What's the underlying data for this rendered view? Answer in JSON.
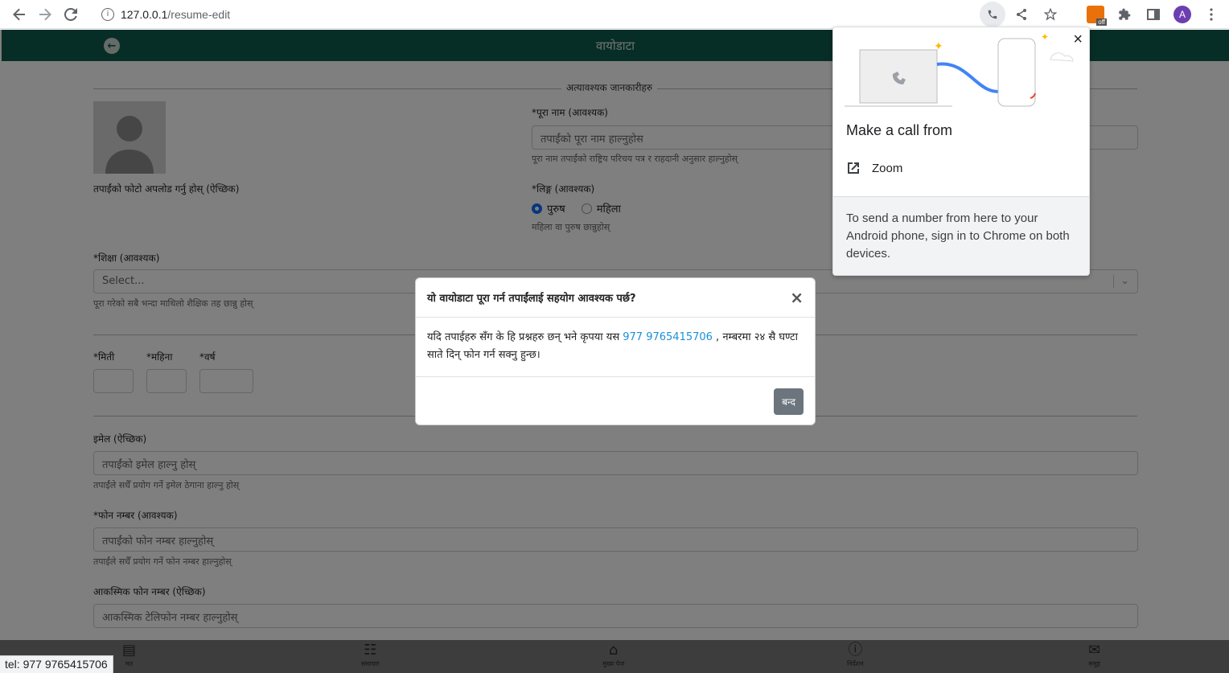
{
  "browser": {
    "url_host": "127.0.0.1",
    "url_path": "/resume-edit",
    "avatar_letter": "A",
    "ext_badge": "off"
  },
  "header": {
    "title": "वायोडाटा"
  },
  "form": {
    "section_essential": "अत्यावश्यक जानकारीहरु",
    "photo_label": "तपाईंको फोटो अपलोड गर्नु होस् (ऐच्छिक)",
    "fullname_label": "*पूरा नाम (आवश्यक)",
    "fullname_placeholder": "तपाईंको पूरा नाम हाल्नुहोस",
    "fullname_help": "पूरा नाम तपाईंको राष्ट्रिय परिचय पत्र र राहदानी अनुसार हाल्नुहोस्",
    "gender_label": "*लिङ्ग (आवश्यक)",
    "gender_male": "पुरुष",
    "gender_female": "महिला",
    "gender_help": "महिला वा पुरुष छान्नुहोस्",
    "education_label": "*शिक्षा (आवश्यक)",
    "education_value": "Select...",
    "education_help": "पूरा गरेको सबै भन्दा माथिलो शैक्षिक तह छान्नु होस्",
    "day_label": "*मिती",
    "month_label": "*महिना",
    "year_label": "*वर्ष",
    "email_label": "इमेल (ऐच्छिक)",
    "email_placeholder": "तपाईंको इमेल हाल्नु होस्",
    "email_help": "तपाईंले सधैँ प्रयोग गर्ने इमेल ठेगाना हाल्नु होस्",
    "phone_label": "*फोन नम्बर (आवश्यक)",
    "phone_placeholder": "तपाईंको फोन नम्बर हाल्नुहोस्",
    "phone_help": "तपाईंले सधैँ प्रयोग गर्ने फोन नम्बर हाल्नुहोस्",
    "emergency_label": "आकस्मिक फोन नम्बर (ऐच्छिक)",
    "emergency_placeholder": "आकस्मिक टेलिफोन नम्बर हाल्नुहोस्"
  },
  "modal": {
    "title": "यो वायोडाटा पूरा गर्न तपाईंलाई सहयोग आवश्यक पर्छ?",
    "body_before": "यदि तपाईहरु सँग के हि प्रश्नहरु छन् भने कृपया यस ",
    "phone": "977 9765415706",
    "body_after": " , नम्बरमा २४ सै घण्टा साते दिन् फोन गर्न सक्नु हुन्छ।",
    "close_button": "बन्द"
  },
  "call_popup": {
    "title": "Make a call from",
    "option": "Zoom",
    "footer": "To send a number from here to your Android phone, sign in to Chrome on both devices."
  },
  "bottom_nav": [
    {
      "label": "मत",
      "icon": "chart-icon"
    },
    {
      "label": "समाचार",
      "icon": "news-icon"
    },
    {
      "label": "मुख्य पेज",
      "icon": "home-icon"
    },
    {
      "label": "निर्देशन",
      "icon": "info-icon"
    },
    {
      "label": "समूह",
      "icon": "chat-icon"
    }
  ],
  "status_tip": "tel: 977 9765415706"
}
